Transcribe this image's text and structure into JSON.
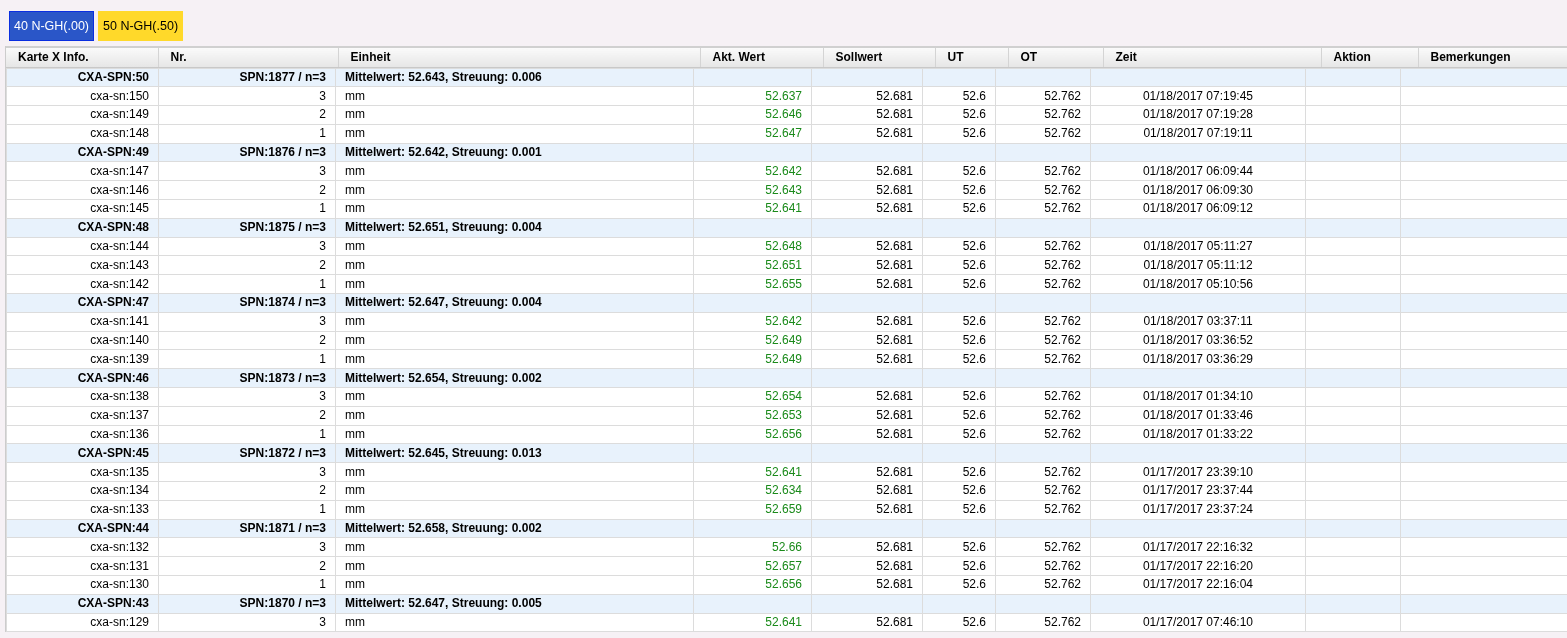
{
  "chart_tabs": [
    {
      "label": "40 N-GH(.00)",
      "color": "#2a56c8",
      "selected": true
    },
    {
      "label": "50 N-GH(.50)",
      "color": "#ffd92a",
      "selected": false
    }
  ],
  "table": {
    "columns": [
      "Karte X Info.",
      "Nr.",
      "Einheit",
      "Akt. Wert",
      "Sollwert",
      "UT",
      "OT",
      "Zeit",
      "Aktion",
      "Bemerkungen"
    ],
    "groups": [
      {
        "label": "CXA-SPN:50",
        "spn": "SPN:1877 / n=3",
        "summary": "Mittelwert: 52.643, Streuung: 0.006",
        "rows": [
          {
            "label": "cxa-sn:150",
            "nr": "3",
            "unit": "mm",
            "value": "52.637",
            "in_tolerance": true,
            "target": "52.681",
            "ut": "52.6",
            "ot": "52.762",
            "time": "01/18/2017 07:19:45"
          },
          {
            "label": "cxa-sn:149",
            "nr": "2",
            "unit": "mm",
            "value": "52.646",
            "in_tolerance": true,
            "target": "52.681",
            "ut": "52.6",
            "ot": "52.762",
            "time": "01/18/2017 07:19:28"
          },
          {
            "label": "cxa-sn:148",
            "nr": "1",
            "unit": "mm",
            "value": "52.647",
            "in_tolerance": true,
            "target": "52.681",
            "ut": "52.6",
            "ot": "52.762",
            "time": "01/18/2017 07:19:11"
          }
        ]
      },
      {
        "label": "CXA-SPN:49",
        "spn": "SPN:1876 / n=3",
        "summary": "Mittelwert: 52.642, Streuung: 0.001",
        "rows": [
          {
            "label": "cxa-sn:147",
            "nr": "3",
            "unit": "mm",
            "value": "52.642",
            "in_tolerance": true,
            "target": "52.681",
            "ut": "52.6",
            "ot": "52.762",
            "time": "01/18/2017 06:09:44"
          },
          {
            "label": "cxa-sn:146",
            "nr": "2",
            "unit": "mm",
            "value": "52.643",
            "in_tolerance": true,
            "target": "52.681",
            "ut": "52.6",
            "ot": "52.762",
            "time": "01/18/2017 06:09:30"
          },
          {
            "label": "cxa-sn:145",
            "nr": "1",
            "unit": "mm",
            "value": "52.641",
            "in_tolerance": true,
            "target": "52.681",
            "ut": "52.6",
            "ot": "52.762",
            "time": "01/18/2017 06:09:12"
          }
        ]
      },
      {
        "label": "CXA-SPN:48",
        "spn": "SPN:1875 / n=3",
        "summary": "Mittelwert: 52.651, Streuung: 0.004",
        "rows": [
          {
            "label": "cxa-sn:144",
            "nr": "3",
            "unit": "mm",
            "value": "52.648",
            "in_tolerance": true,
            "target": "52.681",
            "ut": "52.6",
            "ot": "52.762",
            "time": "01/18/2017 05:11:27"
          },
          {
            "label": "cxa-sn:143",
            "nr": "2",
            "unit": "mm",
            "value": "52.651",
            "in_tolerance": true,
            "target": "52.681",
            "ut": "52.6",
            "ot": "52.762",
            "time": "01/18/2017 05:11:12"
          },
          {
            "label": "cxa-sn:142",
            "nr": "1",
            "unit": "mm",
            "value": "52.655",
            "in_tolerance": true,
            "target": "52.681",
            "ut": "52.6",
            "ot": "52.762",
            "time": "01/18/2017 05:10:56"
          }
        ]
      },
      {
        "label": "CXA-SPN:47",
        "spn": "SPN:1874 / n=3",
        "summary": "Mittelwert: 52.647, Streuung: 0.004",
        "rows": [
          {
            "label": "cxa-sn:141",
            "nr": "3",
            "unit": "mm",
            "value": "52.642",
            "in_tolerance": true,
            "target": "52.681",
            "ut": "52.6",
            "ot": "52.762",
            "time": "01/18/2017 03:37:11"
          },
          {
            "label": "cxa-sn:140",
            "nr": "2",
            "unit": "mm",
            "value": "52.649",
            "in_tolerance": true,
            "target": "52.681",
            "ut": "52.6",
            "ot": "52.762",
            "time": "01/18/2017 03:36:52"
          },
          {
            "label": "cxa-sn:139",
            "nr": "1",
            "unit": "mm",
            "value": "52.649",
            "in_tolerance": true,
            "target": "52.681",
            "ut": "52.6",
            "ot": "52.762",
            "time": "01/18/2017 03:36:29"
          }
        ]
      },
      {
        "label": "CXA-SPN:46",
        "spn": "SPN:1873 / n=3",
        "summary": "Mittelwert: 52.654, Streuung: 0.002",
        "rows": [
          {
            "label": "cxa-sn:138",
            "nr": "3",
            "unit": "mm",
            "value": "52.654",
            "in_tolerance": true,
            "target": "52.681",
            "ut": "52.6",
            "ot": "52.762",
            "time": "01/18/2017 01:34:10"
          },
          {
            "label": "cxa-sn:137",
            "nr": "2",
            "unit": "mm",
            "value": "52.653",
            "in_tolerance": true,
            "target": "52.681",
            "ut": "52.6",
            "ot": "52.762",
            "time": "01/18/2017 01:33:46"
          },
          {
            "label": "cxa-sn:136",
            "nr": "1",
            "unit": "mm",
            "value": "52.656",
            "in_tolerance": true,
            "target": "52.681",
            "ut": "52.6",
            "ot": "52.762",
            "time": "01/18/2017 01:33:22"
          }
        ]
      },
      {
        "label": "CXA-SPN:45",
        "spn": "SPN:1872 / n=3",
        "summary": "Mittelwert: 52.645, Streuung: 0.013",
        "rows": [
          {
            "label": "cxa-sn:135",
            "nr": "3",
            "unit": "mm",
            "value": "52.641",
            "in_tolerance": true,
            "target": "52.681",
            "ut": "52.6",
            "ot": "52.762",
            "time": "01/17/2017 23:39:10"
          },
          {
            "label": "cxa-sn:134",
            "nr": "2",
            "unit": "mm",
            "value": "52.634",
            "in_tolerance": true,
            "target": "52.681",
            "ut": "52.6",
            "ot": "52.762",
            "time": "01/17/2017 23:37:44"
          },
          {
            "label": "cxa-sn:133",
            "nr": "1",
            "unit": "mm",
            "value": "52.659",
            "in_tolerance": true,
            "target": "52.681",
            "ut": "52.6",
            "ot": "52.762",
            "time": "01/17/2017 23:37:24"
          }
        ]
      },
      {
        "label": "CXA-SPN:44",
        "spn": "SPN:1871 / n=3",
        "summary": "Mittelwert: 52.658, Streuung: 0.002",
        "rows": [
          {
            "label": "cxa-sn:132",
            "nr": "3",
            "unit": "mm",
            "value": "52.66",
            "in_tolerance": true,
            "target": "52.681",
            "ut": "52.6",
            "ot": "52.762",
            "time": "01/17/2017 22:16:32"
          },
          {
            "label": "cxa-sn:131",
            "nr": "2",
            "unit": "mm",
            "value": "52.657",
            "in_tolerance": true,
            "target": "52.681",
            "ut": "52.6",
            "ot": "52.762",
            "time": "01/17/2017 22:16:20"
          },
          {
            "label": "cxa-sn:130",
            "nr": "1",
            "unit": "mm",
            "value": "52.656",
            "in_tolerance": true,
            "target": "52.681",
            "ut": "52.6",
            "ot": "52.762",
            "time": "01/17/2017 22:16:04"
          }
        ]
      },
      {
        "label": "CXA-SPN:43",
        "spn": "SPN:1870 / n=3",
        "summary": "Mittelwert: 52.647, Streuung: 0.005",
        "rows": [
          {
            "label": "cxa-sn:129",
            "nr": "3",
            "unit": "mm",
            "value": "52.641",
            "in_tolerance": true,
            "target": "52.681",
            "ut": "52.6",
            "ot": "52.762",
            "time": "01/17/2017 07:46:10"
          }
        ]
      }
    ]
  }
}
